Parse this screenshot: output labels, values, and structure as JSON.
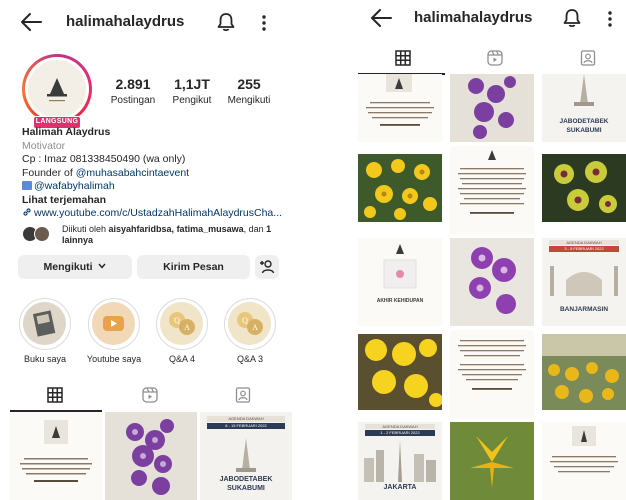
{
  "profile": {
    "username": "halimahalaydrus",
    "live_badge": "LANGSUNG",
    "stats": [
      {
        "value": "2.891",
        "label": "Postingan"
      },
      {
        "value": "1,1JT",
        "label": "Pengikut"
      },
      {
        "value": "255",
        "label": "Mengikuti"
      }
    ],
    "name": "Halimah Alaydrus",
    "category": "Motivator",
    "bio_line1": "Cp : Imaz 081338450490 (wa only)",
    "bio_line2_prefix": "Founder of ",
    "bio_line2_tag": "@muhasabahcintaevent",
    "bio_line3_tag": "@wafabyhalimah",
    "bio_more": "Lihat terjemahan",
    "link": "www.youtube.com/c/UstadzahHalimahAlaydrusCha...",
    "followed_by_prefix": "Diikuti oleh ",
    "followed_by_names": "aisyahfaridbsa, fatima_musawa",
    "followed_by_mid": ", dan ",
    "followed_by_count": "1",
    "followed_by_suffix": "lainnya"
  },
  "actions": {
    "following_label": "Mengikuti",
    "message_label": "Kirim Pesan"
  },
  "highlights": [
    {
      "label": "Buku saya"
    },
    {
      "label": "Youtube saya"
    },
    {
      "label": "Q&A 4"
    },
    {
      "label": "Q&A 3"
    }
  ],
  "posts": {
    "jabodetabek_title": "JABODETABEK",
    "sukabumi_title": "SUKABUMI",
    "date_8_15": "8 - 15 FEBRUARI 2022",
    "date_3_5": "3 - 5 FEBRUARI 2022",
    "date_1_2": "1 - 2 FEBRUARI 2022",
    "banjarmasin_title": "BANJARMASIN",
    "jakarta_title": "JAKARTA",
    "akhir_title": "AKHIR KEHIDUPAN",
    "agenda_label": "AGENDA DAKWAH"
  },
  "colors": {
    "accent": "#e1306c",
    "link": "#00376b",
    "button_bg": "#efefef",
    "text": "#262626",
    "muted": "#8e8e8e"
  },
  "icons": {
    "back": "arrow-left-icon",
    "bell": "bell-icon",
    "more": "more-vertical-icon",
    "grid_tab": "grid-icon",
    "reels_tab": "reels-icon",
    "tagged_tab": "tagged-icon",
    "add_person": "add-person-icon",
    "link": "link-icon",
    "chevron": "chevron-down-icon"
  }
}
